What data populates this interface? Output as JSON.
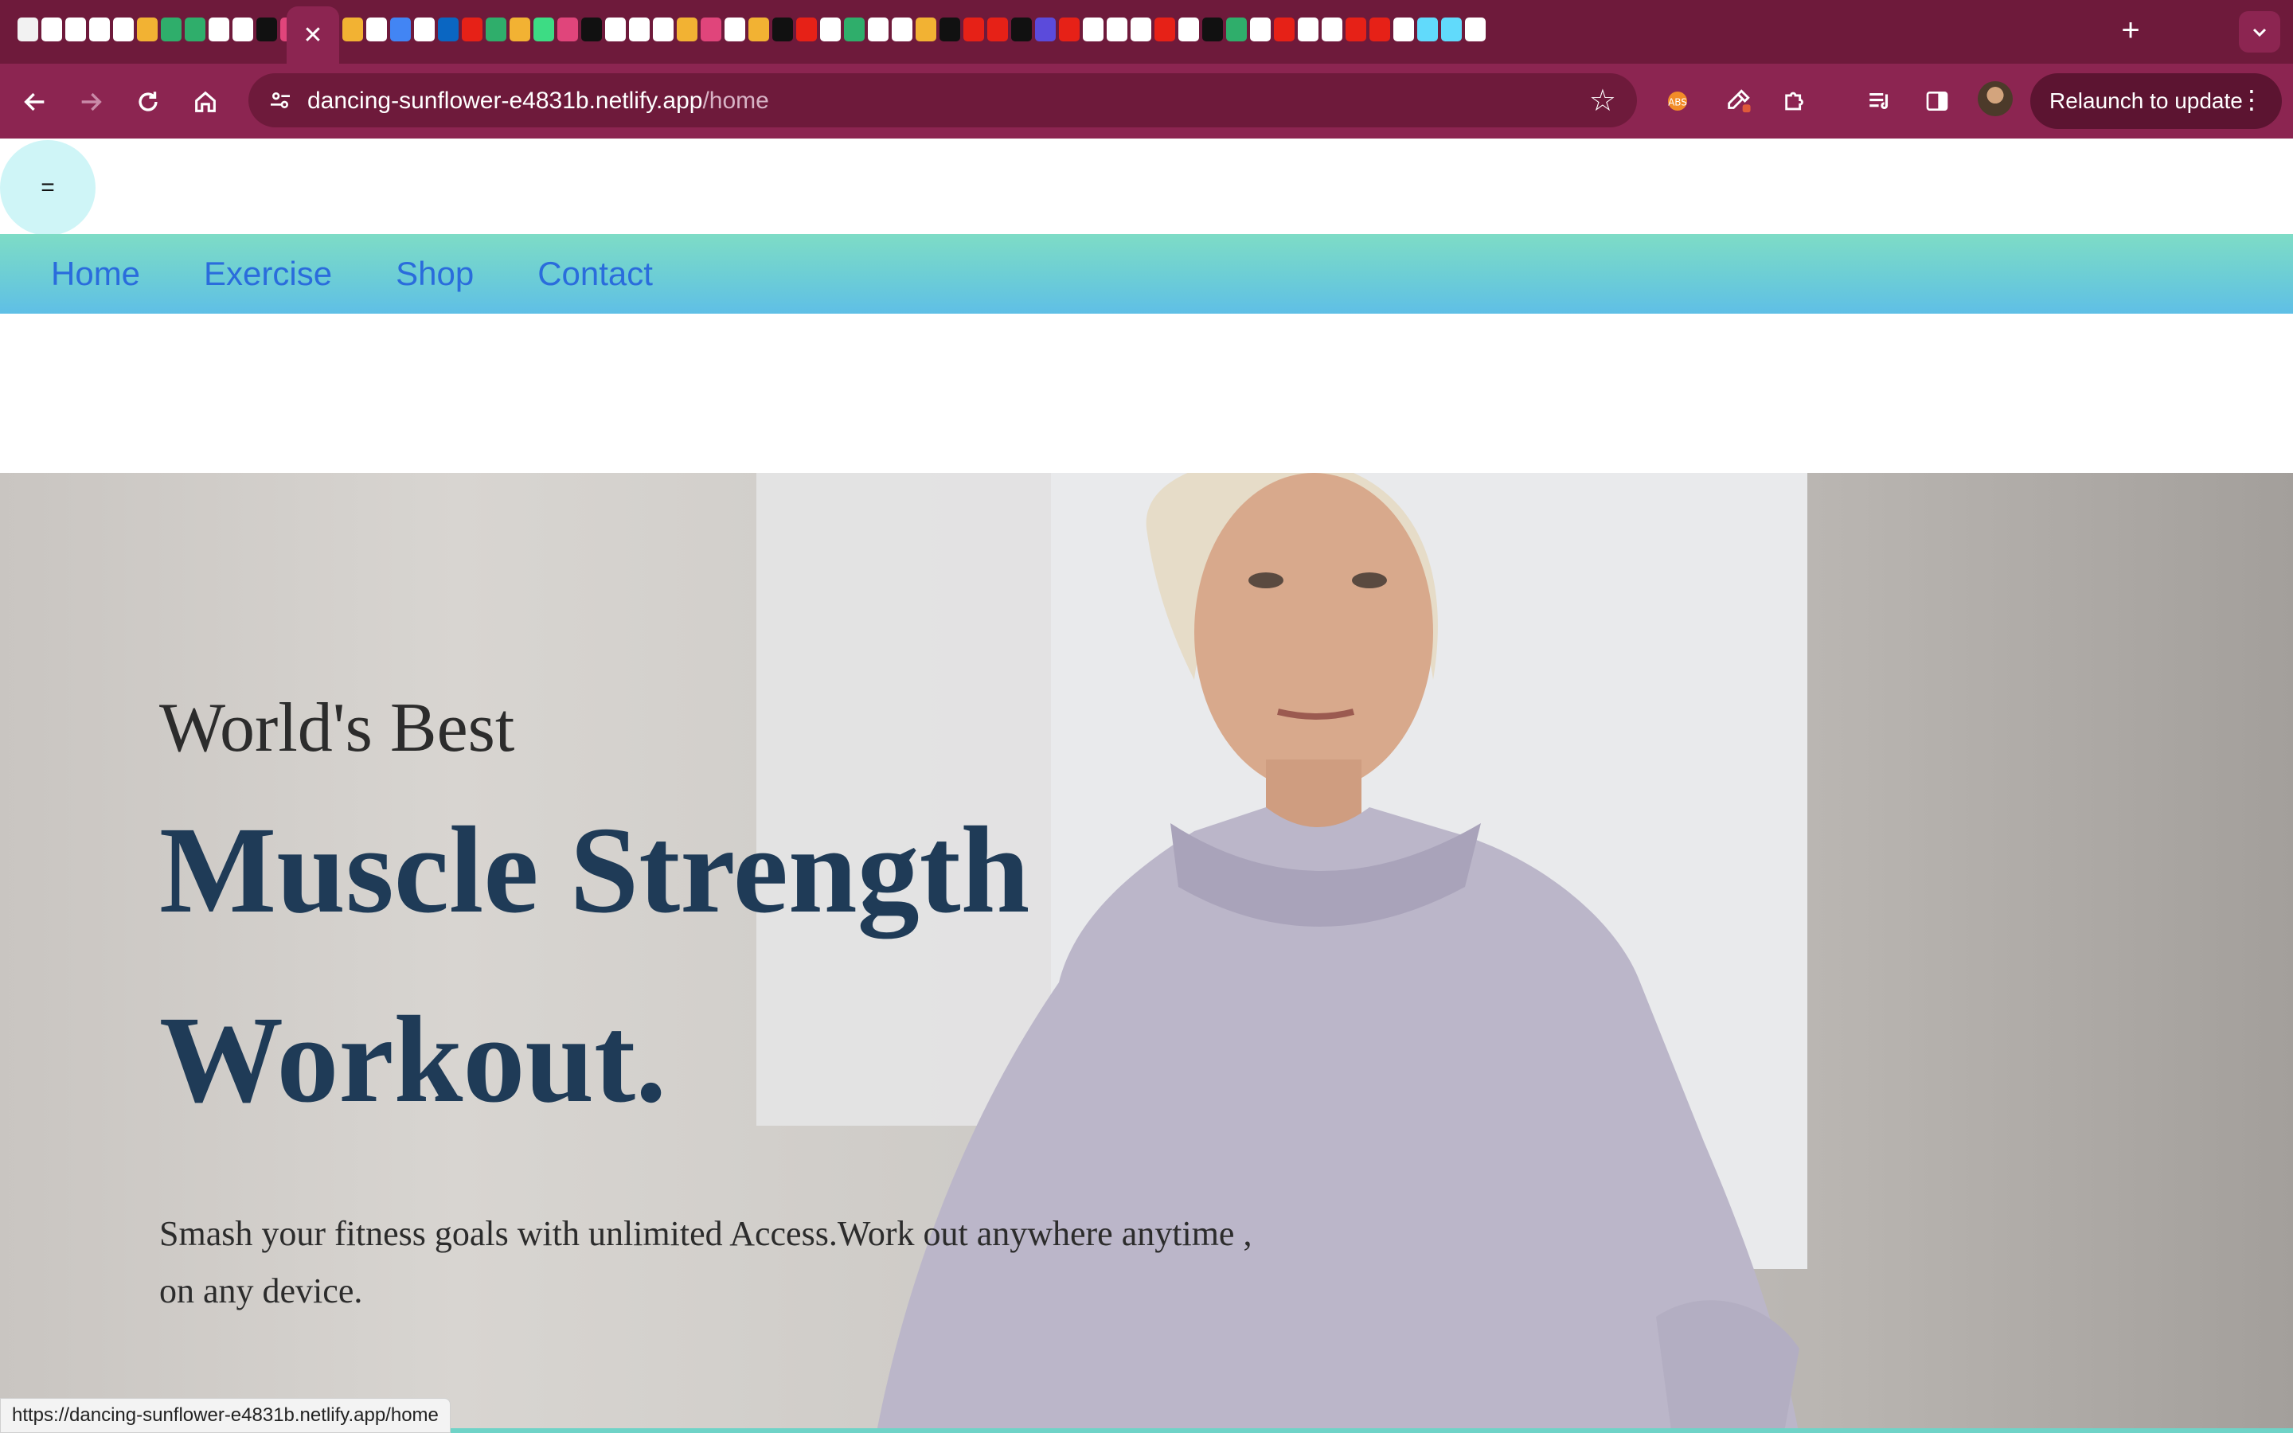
{
  "browser": {
    "url_host": "dancing-sunflower-e4831b.netlify.app",
    "url_path": "/home",
    "relaunch_label": "Relaunch to update",
    "active_tab_close": "✕",
    "new_tab_label": "+",
    "status_url": "https://dancing-sunflower-e4831b.netlify.app/home",
    "colors": {
      "tabstrip": "#6e1a3b",
      "toolbar": "#8c2551"
    }
  },
  "page": {
    "menu_toggle_label": "=",
    "nav": [
      {
        "label": "Home"
      },
      {
        "label": "Exercise"
      },
      {
        "label": "Shop"
      },
      {
        "label": "Contact"
      }
    ],
    "hero": {
      "kicker": "World's Best",
      "headline_line1": "Muscle Strength",
      "headline_line2": "Workout.",
      "subtitle": "Smash your fitness goals with unlimited Access.Work out anywhere anytime , on any device."
    },
    "colors": {
      "nav_link": "#2a6cdc",
      "headline": "#1f3b57",
      "toggle_bg": "#cff5f7"
    }
  }
}
